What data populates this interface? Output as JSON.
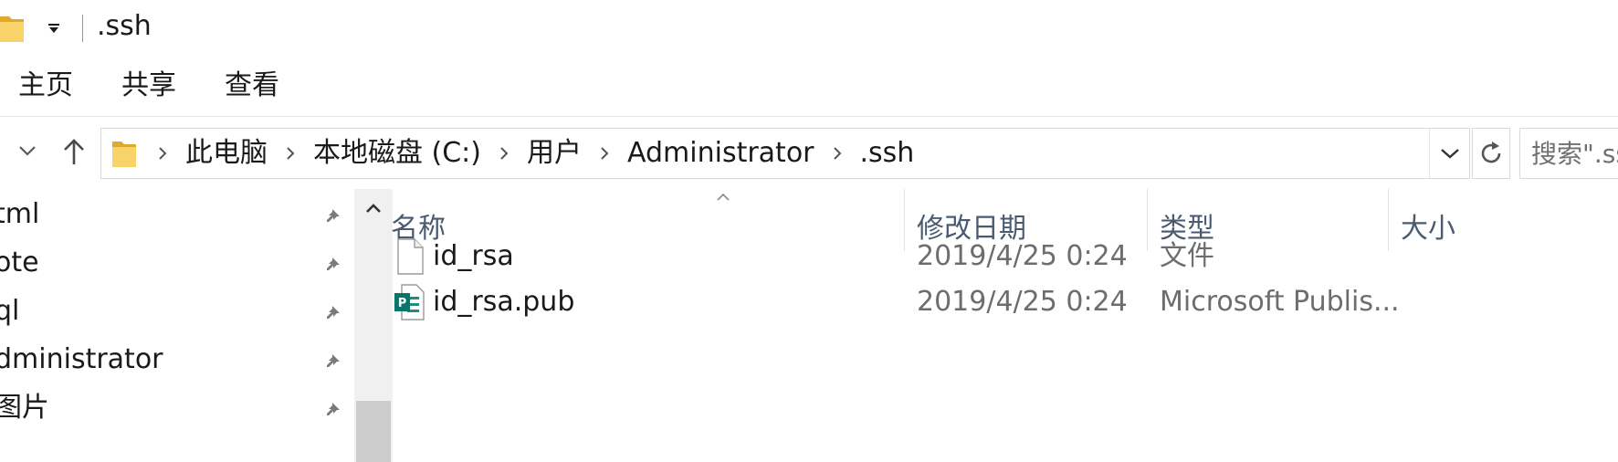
{
  "window": {
    "title": ".ssh",
    "icons": {
      "folder": "folder-icon",
      "quick_access_dropdown": "chevron-down-icon"
    }
  },
  "ribbon": {
    "tabs": [
      {
        "label": "主页"
      },
      {
        "label": "共享"
      },
      {
        "label": "查看"
      }
    ]
  },
  "address": {
    "crumbs": [
      "此电脑",
      "本地磁盘 (C:)",
      "用户",
      "Administrator",
      ".ssh"
    ],
    "search_placeholder": "搜索\".ssh\""
  },
  "navpane": {
    "items": [
      {
        "label": "tml",
        "pinned": true
      },
      {
        "label": "ote",
        "pinned": true
      },
      {
        "label": "ql",
        "pinned": true
      },
      {
        "label": "dministrator",
        "pinned": true
      },
      {
        "label": "图片",
        "pinned": true
      }
    ]
  },
  "columns": {
    "name": "名称",
    "date": "修改日期",
    "type": "类型",
    "size": "大小"
  },
  "files": [
    {
      "name": "id_rsa",
      "date": "2019/4/25 0:24",
      "type": "文件",
      "icon": "blank-file-icon"
    },
    {
      "name": "id_rsa.pub",
      "date": "2019/4/25 0:24",
      "type": "Microsoft Publis...",
      "icon": "publisher-file-icon"
    }
  ],
  "colors": {
    "folder_yellow": "#f3c43f",
    "header_text": "#4a5a70",
    "publisher_green": "#077568"
  }
}
